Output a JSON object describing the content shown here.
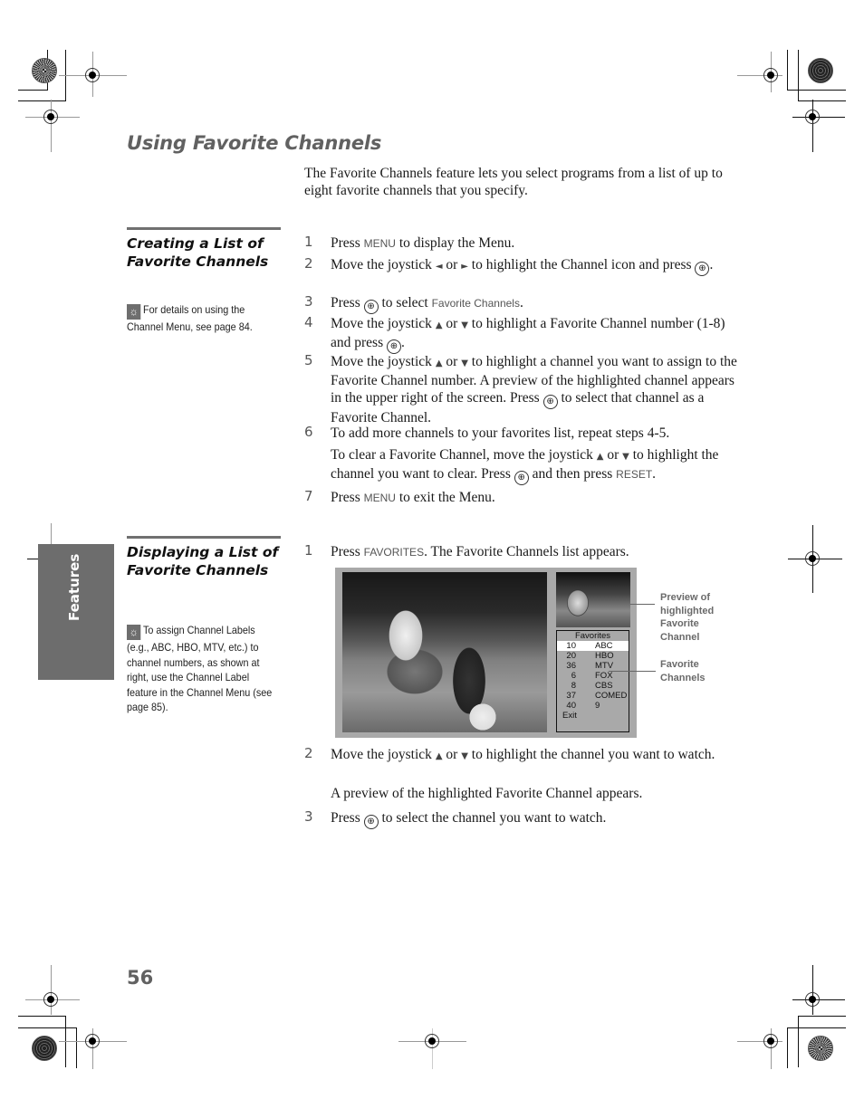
{
  "page": {
    "title": "Using Favorite Channels",
    "intro": "The Favorite Channels feature lets you select programs from a list of up to eight favorite channels that you specify.",
    "side_tab": "Features",
    "page_number": "56"
  },
  "section1": {
    "heading": "Creating a List of Favorite Channels",
    "tip": "For details on using the Channel Menu, see page 84.",
    "steps": [
      {
        "num": "1",
        "parts": [
          "Press ",
          "MENU",
          " to display the Menu."
        ]
      },
      {
        "num": "2",
        "parts": [
          "Move the joystick ",
          "◆",
          " or ",
          "◆",
          " to highlight the Channel icon and press ",
          "⊕",
          "."
        ]
      },
      {
        "num": "3",
        "parts": [
          "Press ",
          "⊕",
          " to select ",
          "Favorite Channels",
          "."
        ]
      },
      {
        "num": "4",
        "parts": [
          "Move the joystick ",
          "▲",
          " or ",
          "▼",
          " to highlight a Favorite Channel number (1-8) and press ",
          "⊕",
          "."
        ]
      },
      {
        "num": "5",
        "parts": [
          "Move the joystick ",
          "▲",
          " or ",
          "▼",
          " to highlight a channel you want to assign to the Favorite Channel number. A preview of the highlighted channel appears in the upper right of the screen. Press ",
          "⊕",
          " to select that channel as a Favorite Channel."
        ]
      },
      {
        "num": "6",
        "parts": [
          "To add more channels to your favorites list, repeat steps 4-5."
        ]
      },
      {
        "num": "",
        "parts": [
          "To clear a Favorite Channel, move the joystick ",
          "▲",
          " or ",
          "▼",
          " to highlight the channel you want to clear. Press ",
          "⊕",
          " and then press ",
          "RESET",
          "."
        ]
      },
      {
        "num": "7",
        "parts": [
          "Press ",
          "MENU",
          " to exit the Menu."
        ]
      }
    ]
  },
  "section2": {
    "heading": "Displaying a List of Favorite Channels",
    "tip": "To assign Channel Labels (e.g., ABC, HBO, MTV, etc.) to channel numbers, as shown at right, use the Channel Label feature in the Channel Menu (see page 85).",
    "steps": [
      {
        "num": "1",
        "parts": [
          "Press ",
          "FAVORITES",
          ". The Favorite Channels list appears."
        ]
      },
      {
        "num": "2",
        "parts": [
          "Move the joystick ",
          "▲",
          " or ",
          "▼",
          " to highlight the channel you want to watch."
        ]
      },
      {
        "num": "",
        "parts": [
          "A preview of the highlighted Favorite Channel appears."
        ]
      },
      {
        "num": "3",
        "parts": [
          "Press ",
          "⊕",
          " to select the channel you want to watch."
        ]
      }
    ]
  },
  "screen": {
    "favorites_title": "Favorites",
    "channels": [
      {
        "number": "10",
        "label": "ABC",
        "highlighted": true
      },
      {
        "number": "20",
        "label": "HBO"
      },
      {
        "number": "36",
        "label": "MTV"
      },
      {
        "number": "6",
        "label": "FOX"
      },
      {
        "number": "8",
        "label": "CBS"
      },
      {
        "number": "37",
        "label": "COMED"
      },
      {
        "number": "40",
        "label": "9"
      }
    ],
    "exit_label": "Exit",
    "callout_preview": "Preview of highlighted Favorite Channel",
    "callout_favorites": "Favorite Channels"
  }
}
